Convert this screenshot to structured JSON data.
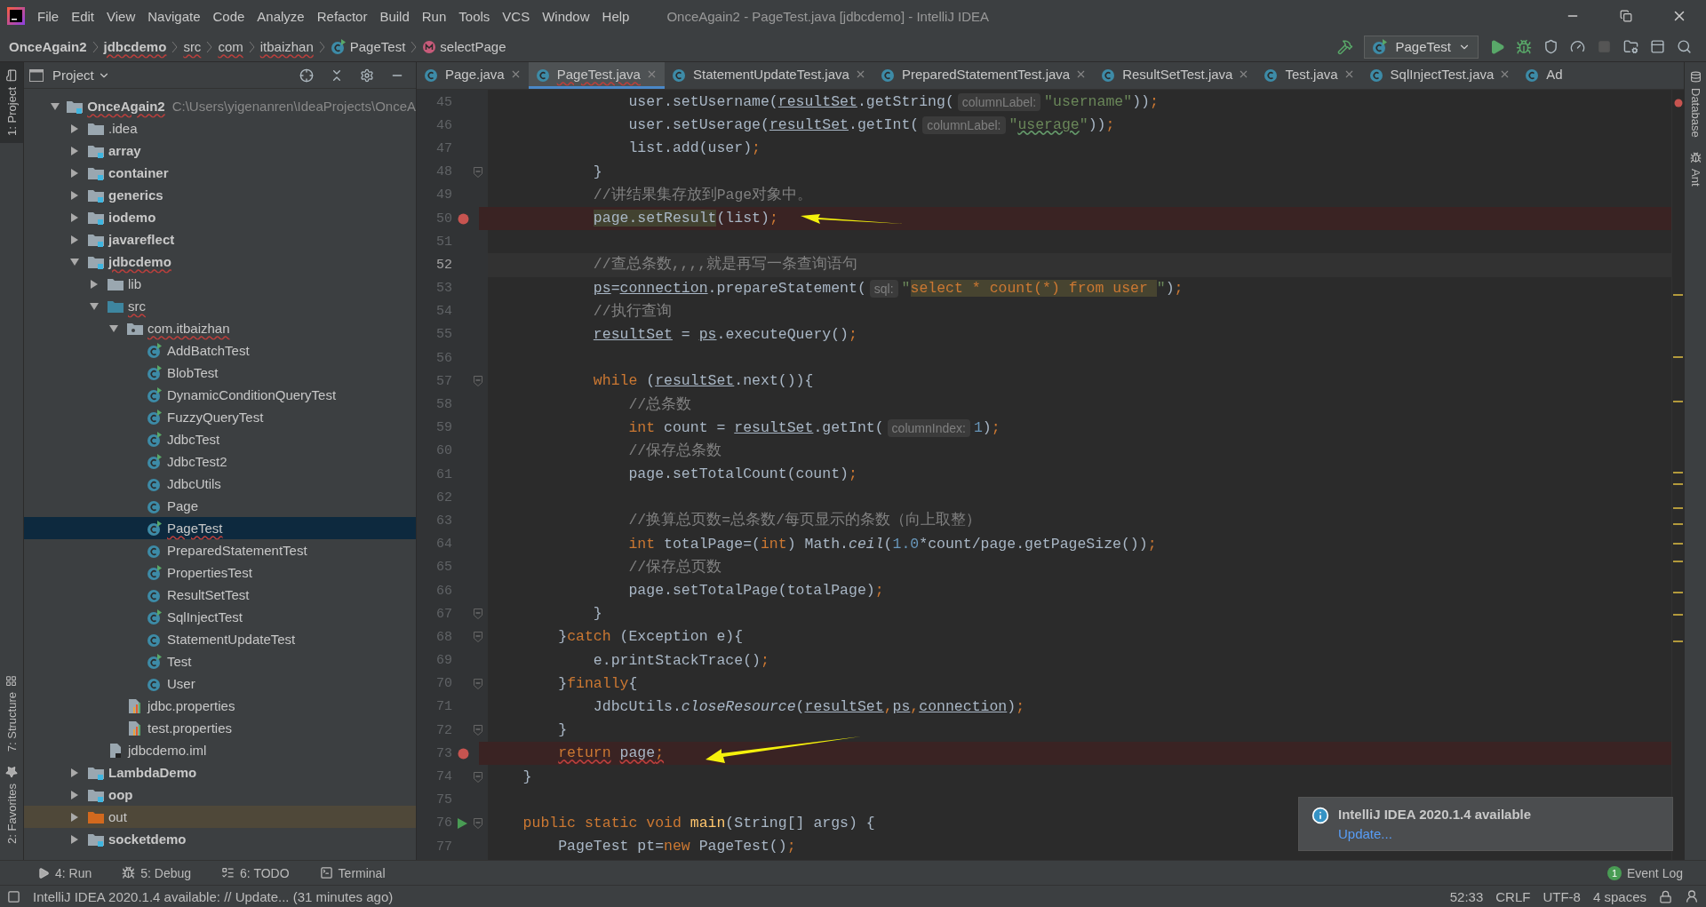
{
  "menu": [
    {
      "label": "File"
    },
    {
      "label": "Edit"
    },
    {
      "label": "View"
    },
    {
      "label": "Navigate"
    },
    {
      "label": "Code"
    },
    {
      "label": "Analyze"
    },
    {
      "label": "Refactor"
    },
    {
      "label": "Build"
    },
    {
      "label": "Run"
    },
    {
      "label": "Tools"
    },
    {
      "label": "VCS"
    },
    {
      "label": "Window"
    },
    {
      "label": "Help"
    }
  ],
  "window": {
    "title": "OnceAgain2 - PageTest.java [jdbcdemo] - IntelliJ IDEA"
  },
  "breadcrumbs": [
    {
      "label": "OnceAgain2",
      "kind": "project",
      "error": false
    },
    {
      "label": "jdbcdemo",
      "kind": "module",
      "error": true
    },
    {
      "label": "src",
      "kind": "folder",
      "error": true
    },
    {
      "label": "com",
      "kind": "folder",
      "error": true
    },
    {
      "label": "itbaizhan",
      "kind": "folder",
      "error": true
    },
    {
      "label": "PageTest",
      "kind": "class",
      "error": false
    },
    {
      "label": "selectPage",
      "kind": "method",
      "error": false
    }
  ],
  "run_config": "PageTest",
  "left_tool_tabs": [
    {
      "label": "1: Project",
      "selected": true
    },
    {
      "label": "7: Structure",
      "selected": false
    },
    {
      "label": "2: Favorites",
      "selected": false
    }
  ],
  "right_tool_tabs": [
    {
      "label": "Database"
    },
    {
      "label": "Ant"
    }
  ],
  "project_panel": {
    "title": "Project"
  },
  "tree": [
    {
      "label": "OnceAgain2",
      "hint": "C:\\Users\\yigenanren\\IdeaProjects\\OnceA",
      "kind": "module",
      "error": true,
      "expanded": true,
      "selected": false,
      "children": [
        {
          "label": ".idea",
          "kind": "folder",
          "expanded": false,
          "selected": false
        },
        {
          "label": "array",
          "kind": "module",
          "expanded": false,
          "selected": false
        },
        {
          "label": "container",
          "kind": "module",
          "expanded": false,
          "selected": false
        },
        {
          "label": "generics",
          "kind": "module",
          "expanded": false,
          "selected": false
        },
        {
          "label": "iodemo",
          "kind": "module",
          "expanded": false,
          "selected": false
        },
        {
          "label": "javareflect",
          "kind": "module",
          "expanded": false,
          "selected": false
        },
        {
          "label": "jdbcdemo",
          "kind": "module",
          "error": true,
          "expanded": true,
          "selected": false,
          "children": [
            {
              "label": "lib",
              "kind": "folder",
              "expanded": false,
              "selected": false
            },
            {
              "label": "src",
              "kind": "source",
              "error": true,
              "expanded": true,
              "selected": false,
              "children": [
                {
                  "label": "com.itbaizhan",
                  "kind": "package",
                  "error": true,
                  "expanded": true,
                  "selected": false,
                  "children": [
                    {
                      "label": "AddBatchTest",
                      "kind": "class",
                      "runnable": true,
                      "selected": false
                    },
                    {
                      "label": "BlobTest",
                      "kind": "class",
                      "runnable": true,
                      "selected": false
                    },
                    {
                      "label": "DynamicConditionQueryTest",
                      "kind": "class",
                      "runnable": true,
                      "selected": false
                    },
                    {
                      "label": "FuzzyQueryTest",
                      "kind": "class",
                      "runnable": true,
                      "selected": false
                    },
                    {
                      "label": "JdbcTest",
                      "kind": "class",
                      "runnable": true,
                      "selected": false
                    },
                    {
                      "label": "JdbcTest2",
                      "kind": "class",
                      "runnable": true,
                      "selected": false
                    },
                    {
                      "label": "JdbcUtils",
                      "kind": "class",
                      "runnable": false,
                      "selected": false
                    },
                    {
                      "label": "Page",
                      "kind": "class",
                      "runnable": false,
                      "selected": false
                    },
                    {
                      "label": "PageTest",
                      "kind": "class",
                      "runnable": true,
                      "error": true,
                      "selected": true
                    },
                    {
                      "label": "PreparedStatementTest",
                      "kind": "class",
                      "runnable": false,
                      "selected": false
                    },
                    {
                      "label": "PropertiesTest",
                      "kind": "class",
                      "runnable": true,
                      "selected": false
                    },
                    {
                      "label": "ResultSetTest",
                      "kind": "class",
                      "runnable": false,
                      "selected": false
                    },
                    {
                      "label": "SqlInjectTest",
                      "kind": "class",
                      "runnable": true,
                      "selected": false
                    },
                    {
                      "label": "StatementUpdateTest",
                      "kind": "class",
                      "runnable": false,
                      "selected": false
                    },
                    {
                      "label": "Test",
                      "kind": "class",
                      "runnable": true,
                      "selected": false
                    },
                    {
                      "label": "User",
                      "kind": "class",
                      "runnable": false,
                      "selected": false
                    }
                  ]
                },
                {
                  "label": "jdbc.properties",
                  "kind": "properties",
                  "selected": false
                },
                {
                  "label": "test.properties",
                  "kind": "properties",
                  "selected": false
                }
              ]
            },
            {
              "label": "jdbcdemo.iml",
              "kind": "iml",
              "selected": false
            }
          ]
        },
        {
          "label": "LambdaDemo",
          "kind": "module",
          "expanded": false,
          "selected": false
        },
        {
          "label": "oop",
          "kind": "module",
          "expanded": false,
          "selected": false
        },
        {
          "label": "out",
          "kind": "excluded",
          "expanded": false,
          "selected": false
        },
        {
          "label": "socketdemo",
          "kind": "module",
          "expanded": false,
          "selected": false
        }
      ]
    }
  ],
  "editor_tabs": [
    {
      "label": "Page.java",
      "selected": false,
      "error": false
    },
    {
      "label": "PageTest.java",
      "selected": true,
      "error": true
    },
    {
      "label": "StatementUpdateTest.java",
      "selected": false,
      "error": false
    },
    {
      "label": "PreparedStatementTest.java",
      "selected": false,
      "error": false
    },
    {
      "label": "ResultSetTest.java",
      "selected": false,
      "error": false
    },
    {
      "label": "Test.java",
      "selected": false,
      "error": false
    },
    {
      "label": "SqlInjectTest.java",
      "selected": false,
      "error": false
    },
    {
      "label": "Ad",
      "selected": false,
      "error": false
    }
  ],
  "code_lines": [
    {
      "number": "45",
      "breakpoint": false,
      "current": false,
      "fold": false,
      "run": false,
      "arrow": false,
      "tokens": [
        {
          "text": "                user.setUsername(",
          "kind": "plain"
        },
        {
          "text": "resultSet",
          "kind": "field"
        },
        {
          "text": ".getString(",
          "kind": "plain"
        },
        {
          "text": "columnLabel:",
          "kind": "hint"
        },
        {
          "text": "\"username\"",
          "kind": "string"
        },
        {
          "text": "))",
          "kind": "plain"
        },
        {
          "text": ";",
          "kind": "keyword"
        }
      ]
    },
    {
      "number": "46",
      "breakpoint": false,
      "current": false,
      "fold": false,
      "run": false,
      "arrow": false,
      "tokens": [
        {
          "text": "                user.setUserage(",
          "kind": "plain"
        },
        {
          "text": "resultSet",
          "kind": "field"
        },
        {
          "text": ".getInt(",
          "kind": "plain"
        },
        {
          "text": "columnLabel:",
          "kind": "hint"
        },
        {
          "text": "\"",
          "kind": "string"
        },
        {
          "text": "userage",
          "kind": "typo"
        },
        {
          "text": "\"",
          "kind": "string"
        },
        {
          "text": "))",
          "kind": "plain"
        },
        {
          "text": ";",
          "kind": "keyword"
        }
      ]
    },
    {
      "number": "47",
      "breakpoint": false,
      "current": false,
      "fold": false,
      "run": false,
      "arrow": false,
      "tokens": [
        {
          "text": "                list.add(user)",
          "kind": "plain"
        },
        {
          "text": ";",
          "kind": "keyword"
        }
      ]
    },
    {
      "number": "48",
      "breakpoint": false,
      "current": false,
      "fold": true,
      "run": false,
      "arrow": false,
      "tokens": [
        {
          "text": "            }",
          "kind": "plain"
        }
      ]
    },
    {
      "number": "49",
      "breakpoint": false,
      "current": false,
      "fold": false,
      "run": false,
      "arrow": false,
      "tokens": [
        {
          "text": "            //讲结果集存放到Page对象中。",
          "kind": "comment"
        }
      ]
    },
    {
      "number": "50",
      "breakpoint": true,
      "current": false,
      "fold": false,
      "run": false,
      "arrow": true,
      "tokens": [
        {
          "text": "            page.setResult",
          "kind": "highlight"
        },
        {
          "text": "(list)",
          "kind": "plain"
        },
        {
          "text": ";",
          "kind": "keyword"
        }
      ]
    },
    {
      "number": "51",
      "breakpoint": false,
      "current": false,
      "fold": false,
      "run": false,
      "arrow": false
    },
    {
      "number": "52",
      "breakpoint": false,
      "current": true,
      "fold": false,
      "run": false,
      "arrow": false,
      "tokens": [
        {
          "text": "            //查总条数,,,,就是再写一条查询语句",
          "kind": "comment"
        }
      ]
    },
    {
      "number": "53",
      "breakpoint": false,
      "current": false,
      "fold": false,
      "run": false,
      "arrow": false,
      "tokens": [
        {
          "text": "            ps",
          "kind": "field"
        },
        {
          "text": "=",
          "kind": "plain"
        },
        {
          "text": "connection",
          "kind": "field"
        },
        {
          "text": ".prepareStatement(",
          "kind": "plain"
        },
        {
          "text": "sql:",
          "kind": "hint"
        },
        {
          "text": "\"",
          "kind": "string"
        },
        {
          "text": "select * count(*) from user ",
          "kind": "sql"
        },
        {
          "text": "\"",
          "kind": "string"
        },
        {
          "text": ")",
          "kind": "plain"
        },
        {
          "text": ";",
          "kind": "keyword"
        }
      ]
    },
    {
      "number": "54",
      "breakpoint": false,
      "current": false,
      "fold": false,
      "run": false,
      "arrow": false,
      "tokens": [
        {
          "text": "            //执行查询",
          "kind": "comment"
        }
      ]
    },
    {
      "number": "55",
      "breakpoint": false,
      "current": false,
      "fold": false,
      "run": false,
      "arrow": false,
      "tokens": [
        {
          "text": "            resultSet",
          "kind": "field"
        },
        {
          "text": " = ",
          "kind": "plain"
        },
        {
          "text": "ps",
          "kind": "field"
        },
        {
          "text": ".executeQuery()",
          "kind": "plain"
        },
        {
          "text": ";",
          "kind": "keyword"
        }
      ]
    },
    {
      "number": "56",
      "breakpoint": false,
      "current": false,
      "fold": false,
      "run": false,
      "arrow": false
    },
    {
      "number": "57",
      "breakpoint": false,
      "current": false,
      "fold": true,
      "run": false,
      "arrow": false,
      "tokens": [
        {
          "text": "            while ",
          "kind": "keyword"
        },
        {
          "text": "(",
          "kind": "plain"
        },
        {
          "text": "resultSet",
          "kind": "field"
        },
        {
          "text": ".next()){",
          "kind": "plain"
        }
      ]
    },
    {
      "number": "58",
      "breakpoint": false,
      "current": false,
      "fold": false,
      "run": false,
      "arrow": false,
      "tokens": [
        {
          "text": "                //总条数",
          "kind": "comment"
        }
      ]
    },
    {
      "number": "59",
      "breakpoint": false,
      "current": false,
      "fold": false,
      "run": false,
      "arrow": false,
      "tokens": [
        {
          "text": "                int ",
          "kind": "keyword"
        },
        {
          "text": "count = ",
          "kind": "plain"
        },
        {
          "text": "resultSet",
          "kind": "field"
        },
        {
          "text": ".getInt(",
          "kind": "plain"
        },
        {
          "text": "columnIndex:",
          "kind": "hint"
        },
        {
          "text": "1",
          "kind": "number"
        },
        {
          "text": ")",
          "kind": "plain"
        },
        {
          "text": ";",
          "kind": "keyword"
        }
      ]
    },
    {
      "number": "60",
      "breakpoint": false,
      "current": false,
      "fold": false,
      "run": false,
      "arrow": false,
      "tokens": [
        {
          "text": "                //保存总条数",
          "kind": "comment"
        }
      ]
    },
    {
      "number": "61",
      "breakpoint": false,
      "current": false,
      "fold": false,
      "run": false,
      "arrow": false,
      "tokens": [
        {
          "text": "                page.setTotalCount(count)",
          "kind": "plain"
        },
        {
          "text": ";",
          "kind": "keyword"
        }
      ]
    },
    {
      "number": "62",
      "breakpoint": false,
      "current": false,
      "fold": false,
      "run": false,
      "arrow": false
    },
    {
      "number": "63",
      "breakpoint": false,
      "current": false,
      "fold": false,
      "run": false,
      "arrow": false,
      "tokens": [
        {
          "text": "                //换算总页数=总条数/每页显示的条数（向上取整）",
          "kind": "comment"
        }
      ]
    },
    {
      "number": "64",
      "breakpoint": false,
      "current": false,
      "fold": false,
      "run": false,
      "arrow": false,
      "tokens": [
        {
          "text": "                int ",
          "kind": "keyword"
        },
        {
          "text": "totalPage=(",
          "kind": "plain"
        },
        {
          "text": "int",
          "kind": "keyword"
        },
        {
          "text": ") Math.",
          "kind": "plain"
        },
        {
          "text": "ceil",
          "kind": "italic"
        },
        {
          "text": "(",
          "kind": "plain"
        },
        {
          "text": "1.0",
          "kind": "number"
        },
        {
          "text": "*count/page.getPageSize())",
          "kind": "plain"
        },
        {
          "text": ";",
          "kind": "keyword"
        }
      ]
    },
    {
      "number": "65",
      "breakpoint": false,
      "current": false,
      "fold": false,
      "run": false,
      "arrow": false,
      "tokens": [
        {
          "text": "                //保存总页数",
          "kind": "comment"
        }
      ]
    },
    {
      "number": "66",
      "breakpoint": false,
      "current": false,
      "fold": false,
      "run": false,
      "arrow": false,
      "tokens": [
        {
          "text": "                page.setTotalPage(totalPage)",
          "kind": "plain"
        },
        {
          "text": ";",
          "kind": "keyword"
        }
      ]
    },
    {
      "number": "67",
      "breakpoint": false,
      "current": false,
      "fold": true,
      "run": false,
      "arrow": false,
      "tokens": [
        {
          "text": "            }",
          "kind": "plain"
        }
      ]
    },
    {
      "number": "68",
      "breakpoint": false,
      "current": false,
      "fold": true,
      "run": false,
      "arrow": false,
      "tokens": [
        {
          "text": "        }",
          "kind": "plain"
        },
        {
          "text": "catch ",
          "kind": "keyword"
        },
        {
          "text": "(Exception e){",
          "kind": "plain"
        }
      ]
    },
    {
      "number": "69",
      "breakpoint": false,
      "current": false,
      "fold": false,
      "run": false,
      "arrow": false,
      "tokens": [
        {
          "text": "            e.printStackTrace()",
          "kind": "plain"
        },
        {
          "text": ";",
          "kind": "keyword"
        }
      ]
    },
    {
      "number": "70",
      "breakpoint": false,
      "current": false,
      "fold": true,
      "run": false,
      "arrow": false,
      "tokens": [
        {
          "text": "        }",
          "kind": "plain"
        },
        {
          "text": "finally",
          "kind": "keyword"
        },
        {
          "text": "{",
          "kind": "plain"
        }
      ]
    },
    {
      "number": "71",
      "breakpoint": false,
      "current": false,
      "fold": false,
      "run": false,
      "arrow": false,
      "tokens": [
        {
          "text": "            JdbcUtils.",
          "kind": "plain"
        },
        {
          "text": "closeResource",
          "kind": "italic"
        },
        {
          "text": "(",
          "kind": "plain"
        },
        {
          "text": "resultSet",
          "kind": "field"
        },
        {
          "text": ",",
          "kind": "keyword"
        },
        {
          "text": "ps",
          "kind": "field"
        },
        {
          "text": ",",
          "kind": "keyword"
        },
        {
          "text": "connection",
          "kind": "field"
        },
        {
          "text": ")",
          "kind": "plain"
        },
        {
          "text": ";",
          "kind": "keyword"
        }
      ]
    },
    {
      "number": "72",
      "breakpoint": false,
      "current": false,
      "fold": true,
      "run": false,
      "arrow": false,
      "tokens": [
        {
          "text": "        }",
          "kind": "plain"
        }
      ]
    },
    {
      "number": "73",
      "breakpoint": true,
      "current": false,
      "fold": false,
      "run": false,
      "arrow": true,
      "tokens": [
        {
          "text": "        return",
          "kind": "error-keyword"
        },
        {
          "text": " page",
          "kind": "error-plain"
        },
        {
          "text": ";",
          "kind": "error-keyword"
        }
      ]
    },
    {
      "number": "74",
      "breakpoint": false,
      "current": false,
      "fold": true,
      "run": false,
      "arrow": false,
      "tokens": [
        {
          "text": "    }",
          "kind": "plain"
        }
      ]
    },
    {
      "number": "75",
      "breakpoint": false,
      "current": false,
      "fold": false,
      "run": false,
      "arrow": false
    },
    {
      "number": "76",
      "breakpoint": false,
      "current": false,
      "fold": true,
      "run": true,
      "arrow": false,
      "tokens": [
        {
          "text": "    public static void ",
          "kind": "keyword"
        },
        {
          "text": "main",
          "kind": "method"
        },
        {
          "text": "(String[] args) {",
          "kind": "plain"
        }
      ]
    },
    {
      "number": "77",
      "breakpoint": false,
      "current": false,
      "fold": false,
      "run": false,
      "arrow": false,
      "tokens": [
        {
          "text": "        PageTest pt=",
          "kind": "plain"
        },
        {
          "text": "new ",
          "kind": "keyword"
        },
        {
          "text": "PageTest()",
          "kind": "plain"
        },
        {
          "text": ";",
          "kind": "keyword"
        }
      ]
    }
  ],
  "notification": {
    "title": "IntelliJ IDEA 2020.1.4 available",
    "link": "Update..."
  },
  "bottom_tools": [
    {
      "label": "4: Run",
      "kind": "run"
    },
    {
      "label": "5: Debug",
      "kind": "debug"
    },
    {
      "label": "6: TODO",
      "kind": "todo"
    },
    {
      "label": "Terminal",
      "kind": "terminal"
    }
  ],
  "event_log": {
    "label": "Event Log",
    "count": "1"
  },
  "status_bar": {
    "message": "IntelliJ IDEA 2020.1.4 available: // Update... (31 minutes ago)",
    "items": [
      "52:33",
      "CRLF",
      "UTF-8",
      "4 spaces"
    ]
  }
}
